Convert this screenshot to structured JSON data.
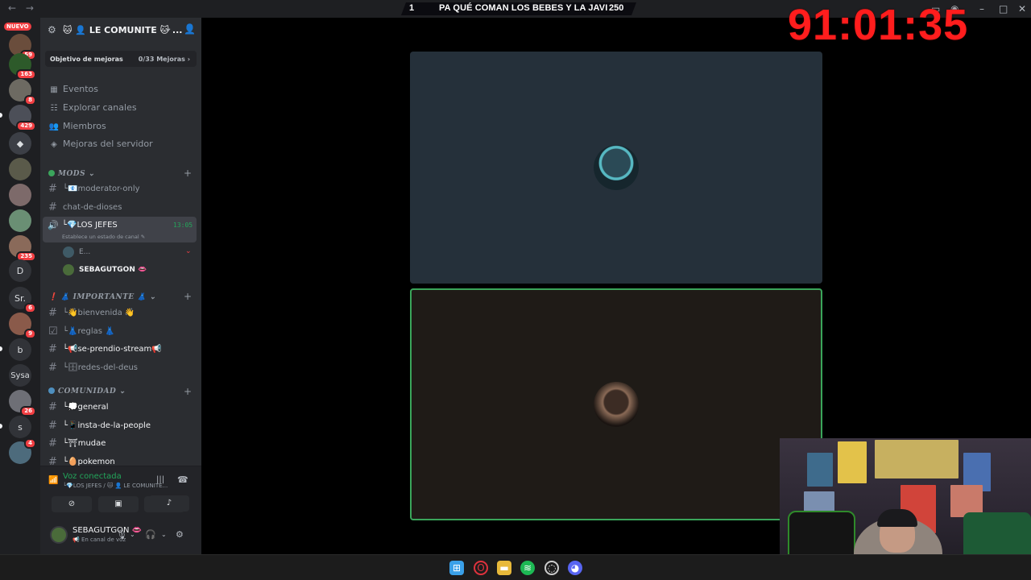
{
  "titlebar": {
    "back": "←",
    "forward": "→"
  },
  "banner": {
    "left": "1",
    "title": "PA QUÉ COMAN LOS BEBES Y LA JAVI",
    "right": "250"
  },
  "timer": "91:01:35",
  "rail": {
    "nuevo": "NUEVO",
    "servers": [
      {
        "badge": "59"
      },
      {
        "badge": "163"
      },
      {
        "badge": "8"
      },
      {
        "badge": "429"
      },
      {
        "badge": ""
      },
      {
        "badge": ""
      },
      {
        "badge": ""
      },
      {
        "badge": ""
      },
      {
        "badge": "235"
      },
      {
        "letter": "D",
        "badge": ""
      },
      {
        "letter": "Sr.",
        "badge": "6"
      },
      {
        "badge": "9"
      },
      {
        "letter": "b",
        "badge": ""
      },
      {
        "letter": "Sysa",
        "badge": ""
      },
      {
        "badge": "26"
      },
      {
        "letter": "s",
        "badge": ""
      },
      {
        "badge": "4"
      }
    ]
  },
  "server": {
    "name": "🐱 👤 LE COMUNITE 🐱 ..."
  },
  "boost": {
    "label": "Objetivo de mejoras",
    "progress": "0/33 Mejoras ›"
  },
  "menu": [
    "Eventos",
    "Explorar canales",
    "Miembros",
    "Mejoras del servidor"
  ],
  "categories": {
    "mods": "MODS",
    "importante": "❗ 👗 IMPORTANTE 👗",
    "comunidad": "COMUNIDAD"
  },
  "channels": {
    "moderator_only": "└📧moderator-only",
    "chat_dioses": "chat-de-dioses",
    "bienvenida": "└👋bienvenida 👋",
    "reglas": "└👗reglas 👗",
    "se_prendio": "└📢se-prendio-stream📢",
    "redes": "└🗄redes-del-deus",
    "general": "└💭general",
    "insta": "└📱insta-de-la-people",
    "mudae": "└⛩mudae",
    "pokemon": "└🥚pokemon"
  },
  "voice_channel": {
    "name": "└💎LOS JEFES",
    "time": "13:05",
    "status": "Establece un estado de canal ✎"
  },
  "voice_users": [
    {
      "name": "E..."
    },
    {
      "name": "SEBAGUTGON 👄"
    }
  ],
  "voice_panel": {
    "status": "Voz conectada",
    "location": "└💎LOS JEFES / 🐱 👤 LE COMUNITE..."
  },
  "user": {
    "name": "SEBAGUTGON 👄",
    "status": "📢 En canal de voz"
  }
}
